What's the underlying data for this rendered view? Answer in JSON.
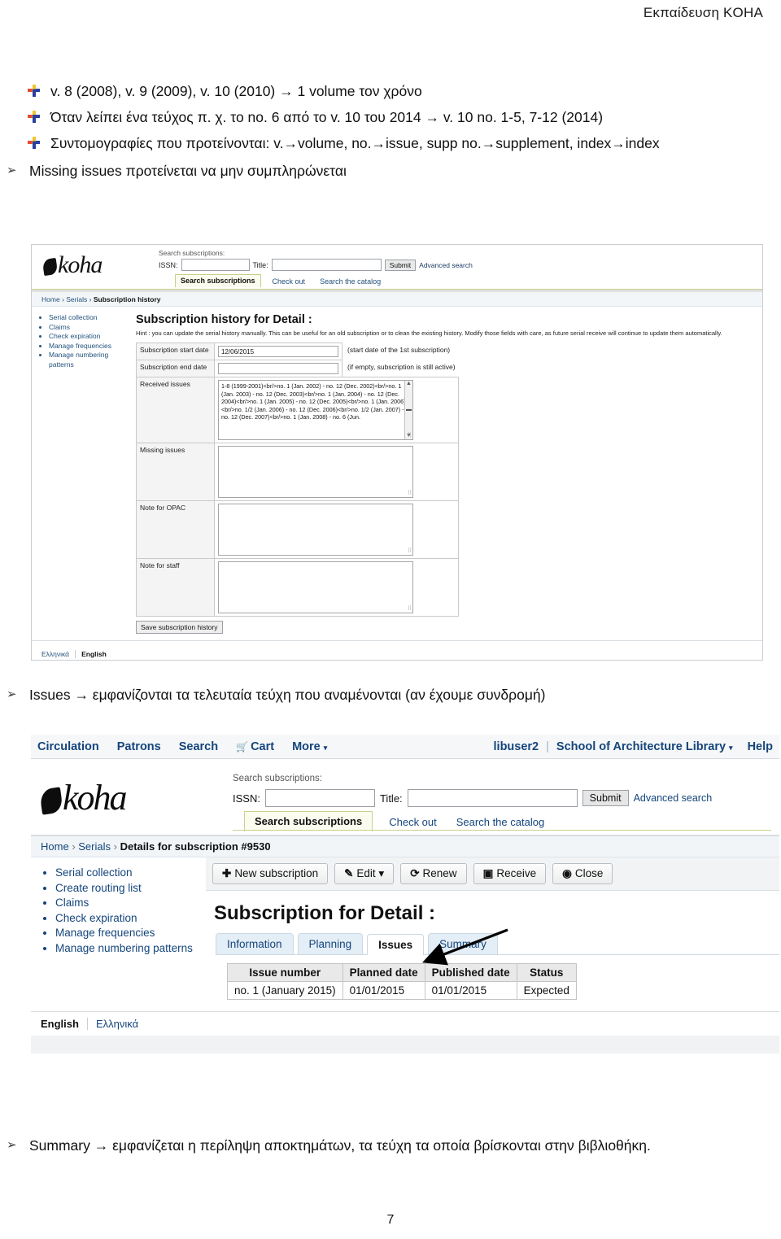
{
  "document": {
    "header": "Εκπαίδευση KOHA",
    "page_number": "7",
    "bullets": [
      "v. 8 (2008), v. 9 (2009), v. 10 (2010) → 1 volume τον χρόνο",
      "Όταν λείπει ένα τεύχος π. χ. το no. 6 από το v. 10 του 2014 → v. 10 no. 1-5, 7-12 (2014)",
      "Συντομογραφίες που προτείνονται: v.→volume, no.→issue, supp no.→supplement, index→index"
    ],
    "note_missing": "Missing issues προτείνεται να μην συμπληρώνεται",
    "note_issues": "Issues → εμφανίζονται τα τελευταία τεύχη που αναμένονται (αν έχουμε συνδρομή)",
    "note_summary": "Summary → εμφανίζεται η περίληψη αποκτημάτων, τα τεύχη τα οποία βρίσκονται στην βιβλιοθήκη."
  },
  "shot1": {
    "logo": "koha",
    "search_label": "Search subscriptions:",
    "issn_label": "ISSN:",
    "issn_value": "",
    "title_label": "Title:",
    "title_value": "",
    "submit_label": "Submit",
    "advanced_label": "Advanced search",
    "tabs": [
      {
        "label": "Search subscriptions",
        "active": true
      },
      {
        "label": "Check out",
        "active": false
      },
      {
        "label": "Search the catalog",
        "active": false
      }
    ],
    "breadcrumb": {
      "home": "Home",
      "serials": "Serials",
      "current": "Subscription history"
    },
    "sidebar": [
      "Serial collection",
      "Claims",
      "Check expiration",
      "Manage frequencies",
      "Manage numbering patterns"
    ],
    "heading": "Subscription history for Detail :",
    "hint": "Hint : you can update the serial history manually. This can be useful for an old subscription or to clean the existing history. Modify those fields with care, as future serial receive will continue to update them automatically.",
    "fields": {
      "start_date_label": "Subscription start date",
      "start_date_value": "12/06/2015",
      "start_date_note": "(start date of the 1st subscription)",
      "end_date_label": "Subscription end date",
      "end_date_value": "",
      "end_date_note": "(if empty, subscription is still active)",
      "received_label": "Received issues",
      "received_value": "1-8 (1999-2001)<br/>no. 1 (Jan. 2002) - no. 12 (Dec. 2002)<br/>no. 1 (Jan. 2003) - no. 12 (Dec. 2003)<br/>no. 1 (Jan. 2004) - no. 12 (Dec. 2004)<br/>no. 1 (Jan. 2005) - no. 12 (Dec. 2005)<br/>no. 1 (Jan. 2006)<br/>no. 1/2 (Jan. 2006) - no. 12 (Dec. 2006)<br/>no. 1/2 (Jan. 2007) - no. 12 (Dec. 2007)<br/>no. 1 (Jan. 2008) - no. 6 (Jun.",
      "missing_label": "Missing issues",
      "missing_value": "",
      "note_opac_label": "Note for OPAC",
      "note_opac_value": "",
      "note_staff_label": "Note for staff",
      "note_staff_value": ""
    },
    "save_label": "Save subscription history",
    "footer": {
      "greek": "Ελληνικά",
      "english": "English"
    }
  },
  "shot2": {
    "nav": [
      "Circulation",
      "Patrons",
      "Search",
      "Cart",
      "More"
    ],
    "user": "libuser2",
    "library": "School of Architecture Library",
    "help": "Help",
    "logo": "koha",
    "search_label": "Search subscriptions:",
    "issn_label": "ISSN:",
    "issn_value": "",
    "title_label": "Title:",
    "title_value": "",
    "submit_label": "Submit",
    "advanced_label": "Advanced search",
    "tabs": [
      {
        "label": "Search subscriptions",
        "active": true
      },
      {
        "label": "Check out",
        "active": false
      },
      {
        "label": "Search the catalog",
        "active": false
      }
    ],
    "breadcrumb": {
      "home": "Home",
      "serials": "Serials",
      "current": "Details for subscription #9530"
    },
    "sidebar": [
      "Serial collection",
      "Create routing list",
      "Claims",
      "Check expiration",
      "Manage frequencies",
      "Manage numbering patterns"
    ],
    "toolbar": [
      {
        "icon": "+",
        "label": "New subscription"
      },
      {
        "icon": "✎",
        "label": "Edit ▾"
      },
      {
        "icon": "⟳",
        "label": "Renew"
      },
      {
        "icon": "▣",
        "label": "Receive"
      },
      {
        "icon": "◉",
        "label": "Close"
      }
    ],
    "heading": "Subscription for Detail :",
    "page_tabs": [
      {
        "label": "Information",
        "active": false
      },
      {
        "label": "Planning",
        "active": false
      },
      {
        "label": "Issues",
        "active": true
      },
      {
        "label": "Summary",
        "active": false
      }
    ],
    "table": {
      "headers": [
        "Issue number",
        "Planned date",
        "Published date",
        "Status"
      ],
      "rows": [
        [
          "no. 1 (January 2015)",
          "01/01/2015",
          "01/01/2015",
          "Expected"
        ]
      ]
    },
    "footer": {
      "english": "English",
      "greek": "Ελληνικά"
    }
  }
}
